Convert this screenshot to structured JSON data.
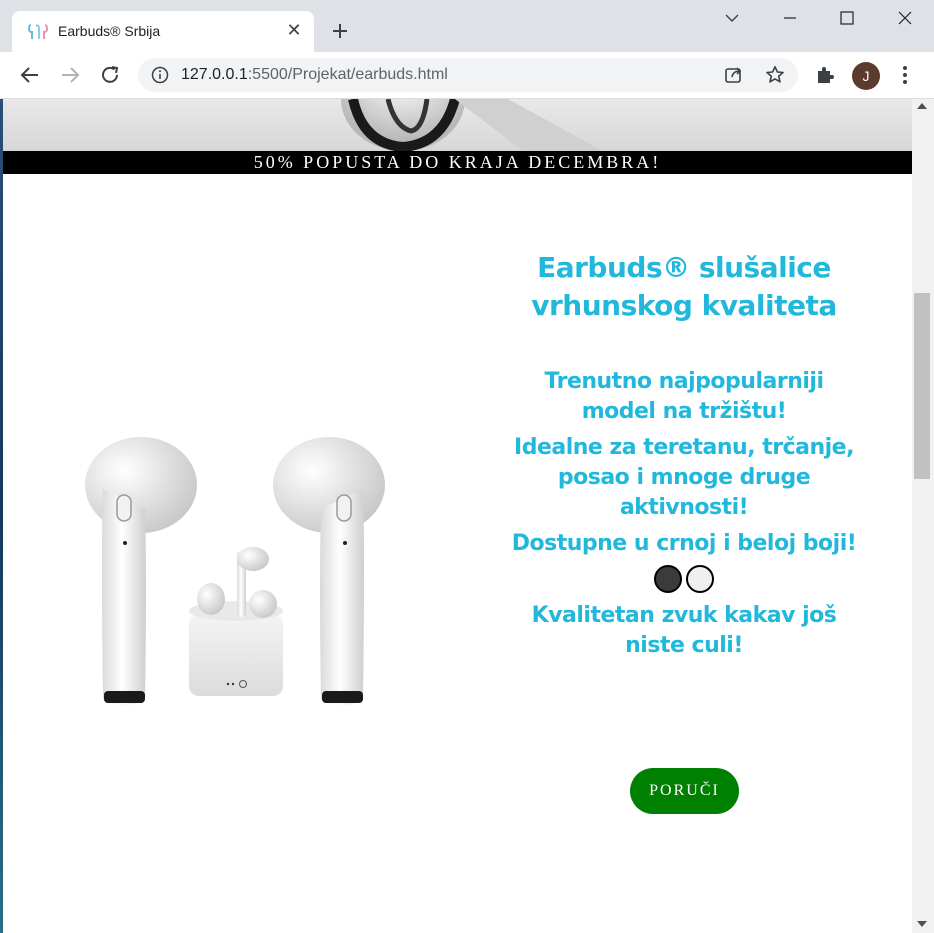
{
  "browser": {
    "tab_title": "Earbuds® Srbija",
    "url_host": "127.0.0.1",
    "url_rest": ":5500/Projekat/earbuds.html",
    "profile_initial": "J"
  },
  "page": {
    "banner": "50% POPUSTA DO KRAJA DECEMBRA!",
    "title_line1": "Earbuds® slušalice",
    "title_line2": "vrhunskog kvaliteta",
    "feature1": "Trenutno najpopularniji model na tržištu!",
    "feature2": "Idealne za teretanu, trčanje, posao i mnoge druge aktivnosti!",
    "feature3": "Dostupne u crnoj i beloj boji!",
    "feature4": "Kvalitetan zvuk kakav još niste culi!",
    "order_button": "PORUČI",
    "colors": {
      "accent": "#22b8dc",
      "button": "#008000",
      "swatch_black": "#3b3b3b",
      "swatch_white": "#f0f0f0"
    }
  }
}
